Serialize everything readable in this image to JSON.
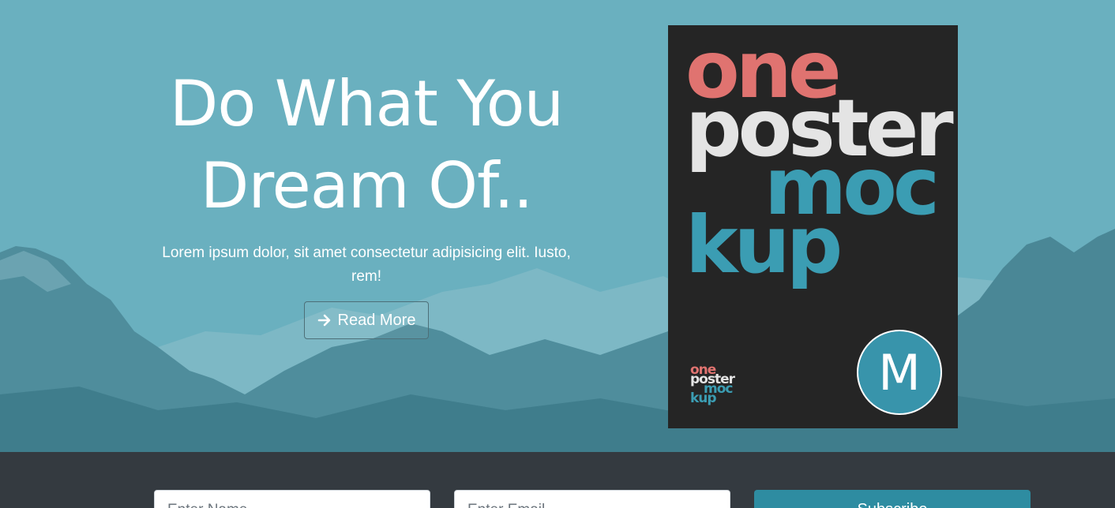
{
  "hero": {
    "headline_line1": "Do What You",
    "headline_line2": "Dream Of..",
    "lead": "Lorem ipsum dolor, sit amet consectetur adipisicing elit. Iusto, rem!",
    "read_more_label": "Read More",
    "read_more_icon": "arrow-right-icon"
  },
  "poster": {
    "lines": [
      "one",
      "poster",
      "moc",
      "kup"
    ],
    "small_lines": [
      "one",
      "poster",
      "moc",
      "kup"
    ],
    "badge_letter": "M",
    "colors": {
      "red": "#e07370",
      "white": "#e4e4e4",
      "teal": "#3b9db3",
      "background": "#252525"
    }
  },
  "subscribe": {
    "name_placeholder": "Enter Name",
    "email_placeholder": "Enter Email",
    "button_label": "Subscribe"
  },
  "colors": {
    "hero_bg": "#6ab0bf",
    "footer_bg": "#343a40",
    "accent": "#2e8ca1"
  }
}
